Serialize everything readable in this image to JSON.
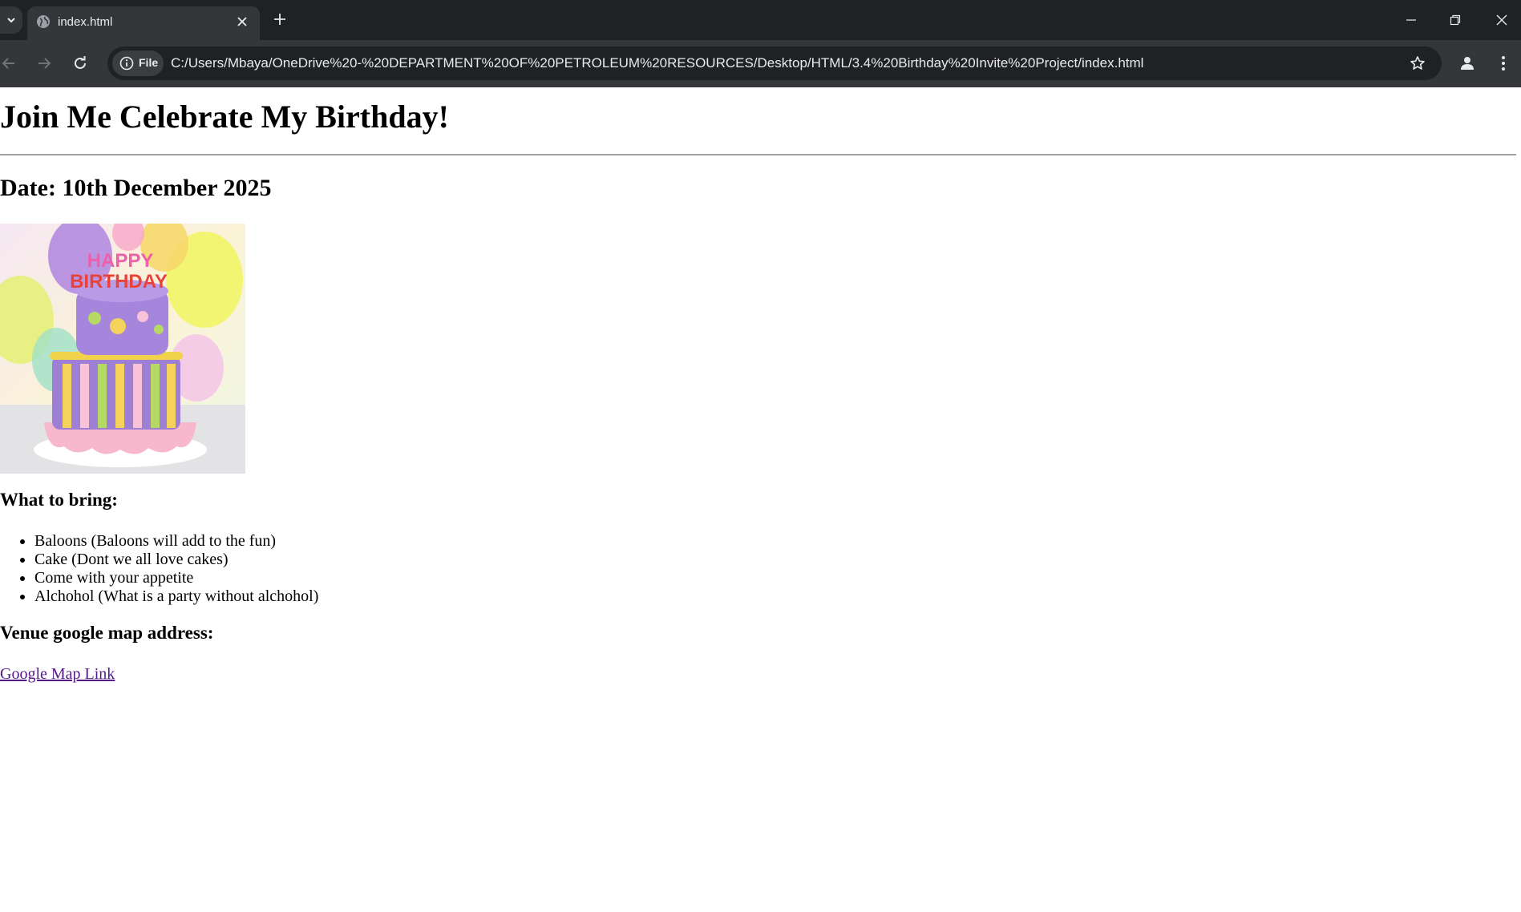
{
  "browser": {
    "tab_title": "index.html",
    "site_chip_label": "File",
    "url": "C:/Users/Mbaya/OneDrive%20-%20DEPARTMENT%20OF%20PETROLEUM%20RESOURCES/Desktop/HTML/3.4%20Birthday%20Invite%20Project/index.html"
  },
  "page": {
    "heading": "Join Me Celebrate My Birthday!",
    "date": "Date: 10th December 2025",
    "cake_text_line1": "HAPPY",
    "cake_text_line2": "BIRTHDAY",
    "bring_heading": "What to bring:",
    "bring_items": [
      "Baloons (Baloons will add to the fun)",
      "Cake (Dont we all love cakes)",
      "Come with your appetite",
      "Alchohol (What is a party without alchohol)"
    ],
    "venue_heading": "Venue google map address:",
    "map_link_label": "Google Map Link"
  },
  "colors": {
    "tabbar_bg": "#202124",
    "toolbar_bg": "#35363a",
    "visited_link": "#551a8b"
  }
}
